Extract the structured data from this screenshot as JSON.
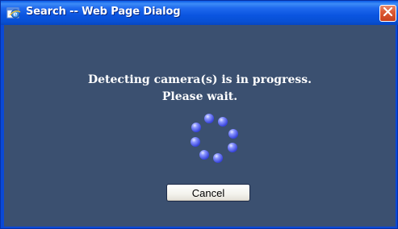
{
  "window": {
    "title": "Search -- Web Page Dialog",
    "icon": "ie-dialog-icon",
    "close_icon": "close-icon"
  },
  "content": {
    "line1": "Detecting camera(s) is in progress.",
    "line2": "Please wait.",
    "spinner_icon": "loading-spinner-icon"
  },
  "buttons": {
    "cancel_label": "Cancel"
  },
  "colors": {
    "titlebar": "#0a55e0",
    "background": "#3b5070",
    "text": "#ffffff",
    "spinner": "#5e6cf4",
    "close": "#dd5a35"
  }
}
